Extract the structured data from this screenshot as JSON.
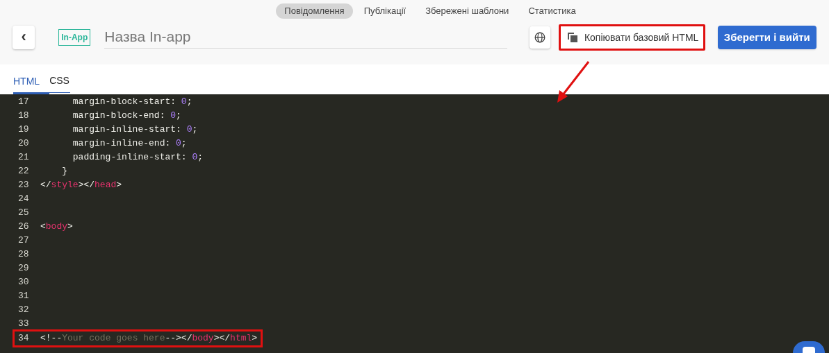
{
  "nav_tabs": [
    {
      "label": "Повідомлення",
      "selected": true
    },
    {
      "label": "Публікації",
      "selected": false
    },
    {
      "label": "Збережені шаблони",
      "selected": false
    },
    {
      "label": "Статистика",
      "selected": false
    }
  ],
  "header": {
    "back_label": "‹",
    "badge": "In-App",
    "name_placeholder": "Назва In-app",
    "copy_button": {
      "label": "Копіювати базовий HTML",
      "highlighted": true
    },
    "save_button": "Зберегти і вийти"
  },
  "editor_tabs": [
    {
      "label": "HTML",
      "selected": true
    },
    {
      "label": "CSS",
      "selected": false
    }
  ],
  "code_lines": [
    {
      "number": "17",
      "highlighted": false,
      "tokens": [
        {
          "kind": "plain",
          "text": "      margin-block-start: "
        },
        {
          "kind": "number",
          "text": "0"
        },
        {
          "kind": "plain",
          "text": ";"
        }
      ]
    },
    {
      "number": "18",
      "highlighted": false,
      "tokens": [
        {
          "kind": "plain",
          "text": "      margin-block-end: "
        },
        {
          "kind": "number",
          "text": "0"
        },
        {
          "kind": "plain",
          "text": ";"
        }
      ]
    },
    {
      "number": "19",
      "highlighted": false,
      "tokens": [
        {
          "kind": "plain",
          "text": "      margin-inline-start: "
        },
        {
          "kind": "number",
          "text": "0"
        },
        {
          "kind": "plain",
          "text": ";"
        }
      ]
    },
    {
      "number": "20",
      "highlighted": false,
      "tokens": [
        {
          "kind": "plain",
          "text": "      margin-inline-end: "
        },
        {
          "kind": "number",
          "text": "0"
        },
        {
          "kind": "plain",
          "text": ";"
        }
      ]
    },
    {
      "number": "21",
      "highlighted": false,
      "tokens": [
        {
          "kind": "plain",
          "text": "      padding-inline-start: "
        },
        {
          "kind": "number",
          "text": "0"
        },
        {
          "kind": "plain",
          "text": ";"
        }
      ]
    },
    {
      "number": "22",
      "highlighted": false,
      "tokens": [
        {
          "kind": "plain",
          "text": "    }"
        }
      ]
    },
    {
      "number": "23",
      "highlighted": false,
      "tokens": [
        {
          "kind": "plain",
          "text": "</"
        },
        {
          "kind": "tag",
          "text": "style"
        },
        {
          "kind": "plain",
          "text": "></"
        },
        {
          "kind": "tag",
          "text": "head"
        },
        {
          "kind": "plain",
          "text": ">"
        }
      ]
    },
    {
      "number": "24",
      "highlighted": false
    },
    {
      "number": "25",
      "highlighted": false
    },
    {
      "number": "26",
      "highlighted": false,
      "tokens": [
        {
          "kind": "plain",
          "text": "<"
        },
        {
          "kind": "tag",
          "text": "body"
        },
        {
          "kind": "plain",
          "text": ">"
        }
      ]
    },
    {
      "number": "27",
      "highlighted": false
    },
    {
      "number": "28",
      "highlighted": false
    },
    {
      "number": "29",
      "highlighted": false
    },
    {
      "number": "30",
      "highlighted": false
    },
    {
      "number": "31",
      "highlighted": false
    },
    {
      "number": "32",
      "highlighted": false
    },
    {
      "number": "33",
      "highlighted": false
    },
    {
      "number": "34",
      "highlighted": true,
      "tokens": [
        {
          "kind": "plain",
          "text": "<!--"
        },
        {
          "kind": "comment",
          "text": "Your code goes here"
        },
        {
          "kind": "plain",
          "text": "--></"
        },
        {
          "kind": "tag",
          "text": "body"
        },
        {
          "kind": "plain",
          "text": "></"
        },
        {
          "kind": "tag",
          "text": "html"
        },
        {
          "kind": "plain",
          "text": ">"
        }
      ]
    }
  ]
}
